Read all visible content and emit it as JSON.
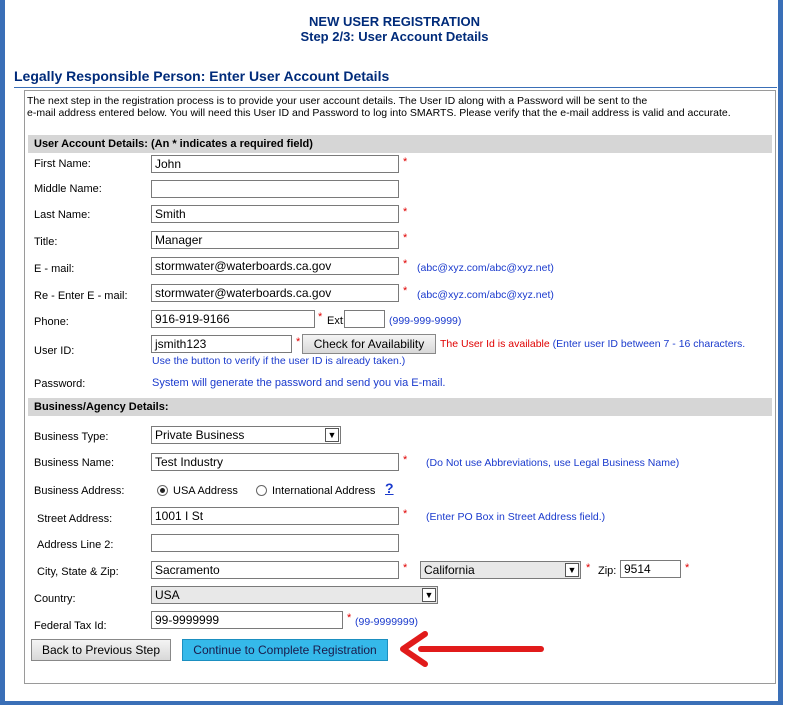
{
  "header": {
    "title": "NEW USER REGISTRATION",
    "step": "Step 2/3: User Account Details"
  },
  "section_title": "Legally Responsible Person: Enter User Account Details",
  "intro": {
    "line1": "The next step in the registration process is to provide your user account details. The User ID along with a Password will be sent to the",
    "line2": "e-mail address entered below. You will need this User ID and Password to log into SMARTS. Please verify that the e-mail address is valid and accurate."
  },
  "account": {
    "heading": "User Account Details: (An * indicates a required field)",
    "first_name": {
      "label": "First Name:",
      "value": "John"
    },
    "middle_name": {
      "label": "Middle Name:",
      "value": ""
    },
    "last_name": {
      "label": "Last Name:",
      "value": "Smith"
    },
    "title": {
      "label": "Title:",
      "value": "Manager"
    },
    "email": {
      "label": "E - mail:",
      "value": "stormwater@waterboards.ca.gov",
      "hint": "(abc@xyz.com/abc@xyz.net)"
    },
    "reemail": {
      "label": "Re - Enter E - mail:",
      "value": "stormwater@waterboards.ca.gov",
      "hint": "(abc@xyz.com/abc@xyz.net)"
    },
    "phone": {
      "label": "Phone:",
      "value": "916-919-9166",
      "ext_label": "Ext:",
      "ext_value": "",
      "hint": "(999-999-9999)"
    },
    "userid": {
      "label": "User ID:",
      "value": "jsmith123",
      "check_button": "Check for Availability",
      "available": "The User Id is available",
      "hint": "(Enter user ID between 7 - 16 characters.",
      "hint2": "Use the button to verify if the user ID is already taken.)"
    },
    "password": {
      "label": "Password:",
      "note": "System will generate the password and send you via E-mail."
    }
  },
  "business": {
    "heading": "Business/Agency Details:",
    "type": {
      "label": "Business Type:",
      "value": "Private Business"
    },
    "name": {
      "label": "Business Name:",
      "value": "Test Industry",
      "hint": "(Do Not use Abbreviations, use Legal Business Name)"
    },
    "address": {
      "label": "Business Address:",
      "opt_usa": "USA Address",
      "opt_intl": "International Address",
      "help": "?"
    },
    "street": {
      "label": "Street Address:",
      "value": "1001 I St",
      "hint": "(Enter PO Box in Street Address field.)"
    },
    "line2": {
      "label": "Address Line 2:",
      "value": ""
    },
    "city": {
      "label": "City, State & Zip:",
      "value": "Sacramento",
      "state": "California",
      "zip_label": "Zip:",
      "zip": "9514"
    },
    "country": {
      "label": "Country:",
      "value": "USA"
    },
    "taxid": {
      "label": "Federal Tax Id:",
      "value": "99-9999999",
      "hint": "(99-9999999)"
    }
  },
  "buttons": {
    "back": "Back to Previous Step",
    "continue": "Continue to Complete Registration"
  },
  "required_mark": "*",
  "colors": {
    "accent": "#3a6fb7",
    "title": "#002b7a",
    "hint": "#1a3acd",
    "required": "#e00000",
    "primary_button": "#35b9ea",
    "arrow": "#e11b1b"
  }
}
